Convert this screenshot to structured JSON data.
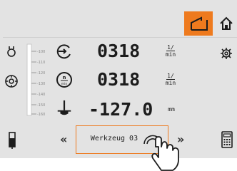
{
  "top_buttons": {
    "select_icon": "select-frame-icon",
    "home_icon": "home-icon",
    "accent_color": "#ee7a1e"
  },
  "left_icons": [
    "tool-holder-icon",
    "spindle-icon",
    "coolant-icon"
  ],
  "right_icons": [
    "settings-gear-icon",
    "calculator-icon"
  ],
  "scale": {
    "labels": [
      "-100",
      "-110",
      "-120",
      "-130",
      "-140",
      "-150",
      "-160"
    ]
  },
  "readouts": [
    {
      "icon": "speed-dial-icon",
      "value": "0318",
      "unit_num": "1/",
      "unit_den": "min"
    },
    {
      "icon": "rpm-icon",
      "value": "0318",
      "unit_num": "1/",
      "unit_den": "min"
    },
    {
      "icon": "depth-icon",
      "value": "-127.0",
      "unit": "mm"
    }
  ],
  "bottom": {
    "prev": "«",
    "next": "»",
    "tool_label": "Werkzeug 03",
    "tap_icon": "hand-tap-icon"
  }
}
